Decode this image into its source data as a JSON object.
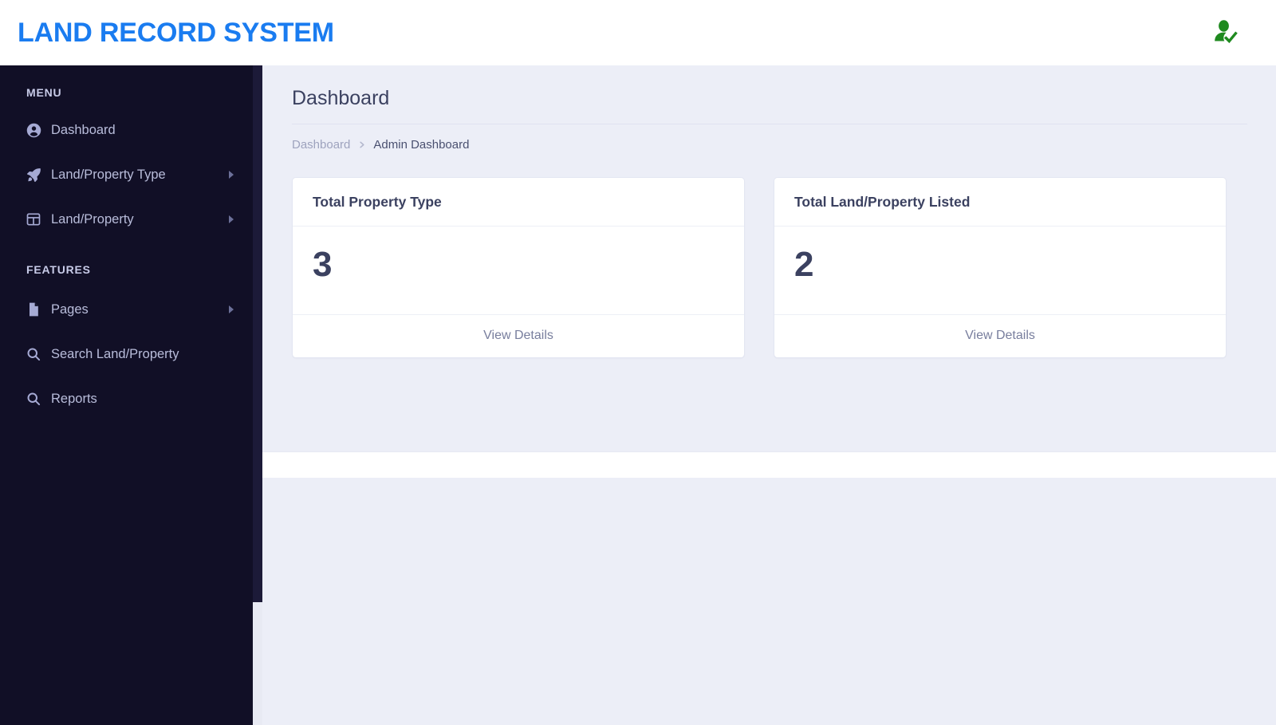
{
  "header": {
    "brand": "LAND RECORD SYSTEM",
    "user_icon": "user-check-icon",
    "brand_color": "#1a7cf0",
    "user_icon_color": "#1f8a1f"
  },
  "sidebar": {
    "background_color": "#110f26",
    "sections": [
      {
        "title": "MENU",
        "items": [
          {
            "label": "Dashboard",
            "icon": "user-circle-icon",
            "has_submenu": false
          },
          {
            "label": "Land/Property Type",
            "icon": "rocket-icon",
            "has_submenu": true
          },
          {
            "label": "Land/Property",
            "icon": "table-grid-icon",
            "has_submenu": true
          }
        ]
      },
      {
        "title": "FEATURES",
        "items": [
          {
            "label": "Pages",
            "icon": "document-icon",
            "has_submenu": true
          },
          {
            "label": "Search Land/Property",
            "icon": "search-icon",
            "has_submenu": false
          },
          {
            "label": "Reports",
            "icon": "search-icon",
            "has_submenu": false
          }
        ]
      }
    ]
  },
  "main": {
    "page_title": "Dashboard",
    "breadcrumb": {
      "parent": "Dashboard",
      "separator": "›",
      "current": "Admin Dashboard"
    },
    "cards": [
      {
        "title": "Total Property Type",
        "value": "3",
        "action": "View Details"
      },
      {
        "title": "Total Land/Property Listed",
        "value": "2",
        "action": "View Details"
      }
    ]
  }
}
